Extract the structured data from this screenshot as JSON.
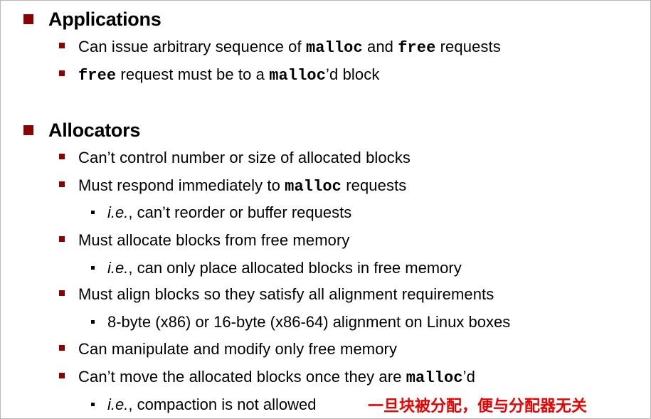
{
  "applications": {
    "heading": "Applications",
    "item1": {
      "pre": "Can issue arbitrary sequence of ",
      "code1": "malloc",
      "mid": " and ",
      "code2": "free",
      "post": " requests"
    },
    "item2": {
      "code1": "free",
      "mid": " request must be to a ",
      "code2": "malloc",
      "post": "’d  block"
    }
  },
  "allocators": {
    "heading": "Allocators",
    "item1": "Can’t control number or size of allocated blocks",
    "item2": {
      "pre": "Must respond immediately to ",
      "code": "malloc",
      "post": " requests"
    },
    "item2_sub": {
      "ie": "i.e.",
      "text": ", can’t reorder or buffer requests"
    },
    "item3": "Must allocate blocks from free memory",
    "item3_sub": {
      "ie": "i.e.",
      "text": ", can only place allocated blocks in free memory"
    },
    "item4": "Must align blocks so they satisfy all alignment requirements",
    "item4_sub": "8-byte (x86) or 16-byte (x86-64) alignment on Linux boxes",
    "item5": "Can manipulate and modify only free memory",
    "item6": {
      "pre": "Can’t move the allocated blocks once they are ",
      "code": "malloc",
      "post": "’d"
    },
    "item6_sub": {
      "ie": "i.e.",
      "text": ", compaction is not allowed"
    }
  },
  "annotation": "一旦块被分配，便与分配器无关",
  "colors": {
    "bullet": "#8b0000",
    "annotation": "#ee0000"
  }
}
